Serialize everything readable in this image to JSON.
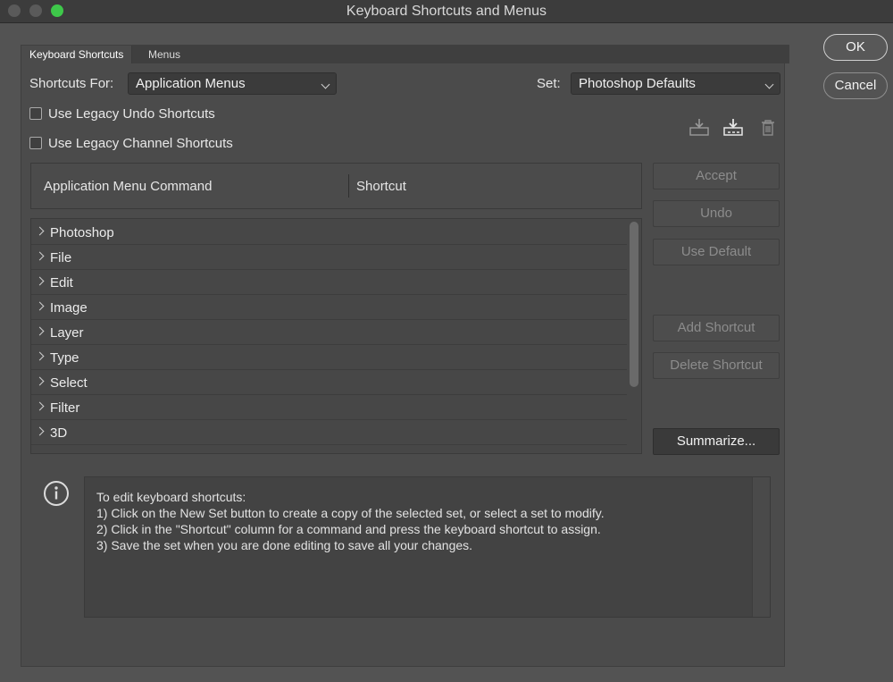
{
  "window": {
    "title": "Keyboard Shortcuts and Menus"
  },
  "tabs": [
    {
      "label": "Keyboard Shortcuts",
      "active": true
    },
    {
      "label": "Menus",
      "active": false
    }
  ],
  "shortcuts_for": {
    "label": "Shortcuts For:",
    "value": "Application Menus"
  },
  "set": {
    "label": "Set:",
    "value": "Photoshop Defaults"
  },
  "options": {
    "legacy_undo": {
      "label": "Use Legacy Undo Shortcuts",
      "checked": false
    },
    "legacy_channel": {
      "label": "Use Legacy Channel Shortcuts",
      "checked": false
    }
  },
  "set_icons": [
    "save-set-icon",
    "save-as-new-set-icon",
    "delete-set-icon"
  ],
  "table": {
    "columns": [
      "Application Menu Command",
      "Shortcut"
    ],
    "rows": [
      "Photoshop",
      "File",
      "Edit",
      "Image",
      "Layer",
      "Type",
      "Select",
      "Filter",
      "3D"
    ]
  },
  "actions": {
    "accept": "Accept",
    "undo": "Undo",
    "use_default": "Use Default",
    "add_shortcut": "Add Shortcut",
    "delete_shortcut": "Delete Shortcut",
    "summarize": "Summarize..."
  },
  "dialog_buttons": {
    "ok": "OK",
    "cancel": "Cancel"
  },
  "info": {
    "lines": [
      "To edit keyboard shortcuts:",
      "1) Click on the New Set button to create a copy of the selected set, or select a set to modify.",
      "2) Click in the \"Shortcut\" column for a command and press the keyboard shortcut to assign.",
      "3) Save the set when you are done editing to save all your changes."
    ]
  }
}
